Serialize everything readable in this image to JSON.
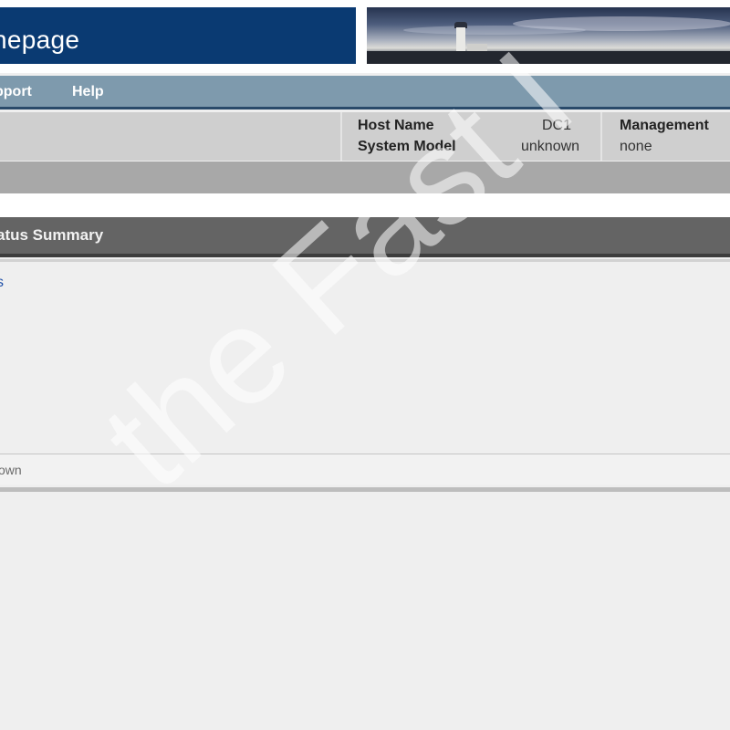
{
  "header": {
    "title": "nepage"
  },
  "nav": {
    "items": [
      {
        "label": "pport"
      },
      {
        "label": "Help"
      }
    ]
  },
  "info": {
    "host_name_label": "Host Name",
    "host_name_value": "DC1",
    "system_model_label": "System Model",
    "system_model_value": "unknown",
    "management_label": "Management",
    "management_value": "none"
  },
  "section": {
    "title": "atus Summary",
    "link": "s",
    "status_text": "own"
  },
  "watermark": "the Fast I",
  "colors": {
    "title_bar": "#0a3a72",
    "nav": "#7e9aad",
    "section_header": "#646464",
    "link": "#2050a8"
  }
}
